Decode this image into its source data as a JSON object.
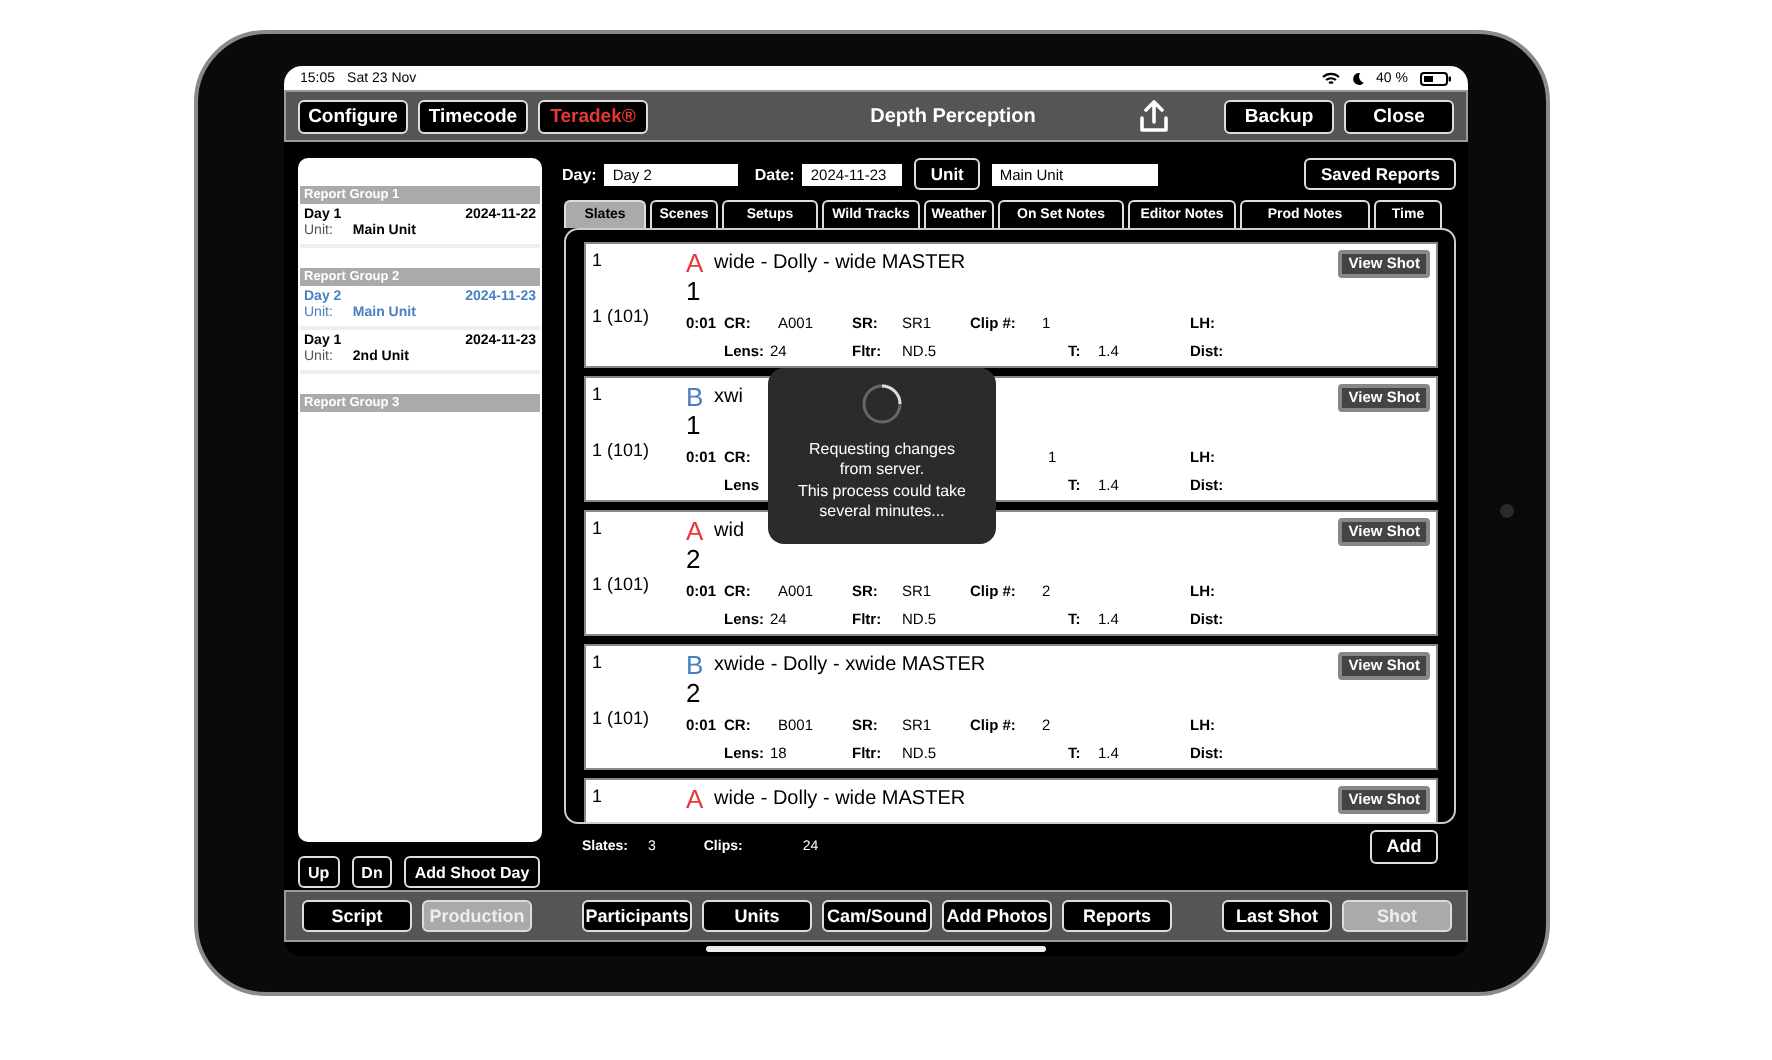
{
  "status_bar": {
    "time": "15:05",
    "date": "Sat 23 Nov",
    "battery": "40 %"
  },
  "toolbar": {
    "buttons_left": [
      {
        "label": "Configure",
        "kind": "normal"
      },
      {
        "label": "Timecode",
        "kind": "normal"
      },
      {
        "label": "Teradek®",
        "kind": "alert"
      }
    ],
    "title": "Depth Perception",
    "buttons_right": [
      "Backup",
      "Close"
    ]
  },
  "form": {
    "day_label": "Day:",
    "day": "Day 2",
    "date_label": "Date:",
    "date": "2024-11-23",
    "unit_button": "Unit",
    "unit": "Main Unit",
    "saved_reports": "Saved Reports"
  },
  "tabs": [
    {
      "label": "Slates",
      "selected": true
    },
    {
      "label": "Scenes",
      "selected": false
    },
    {
      "label": "Setups",
      "selected": false
    },
    {
      "label": "Wild Tracks",
      "selected": false
    },
    {
      "label": "Weather",
      "selected": false
    },
    {
      "label": "On Set Notes",
      "selected": false
    },
    {
      "label": "Editor Notes",
      "selected": false
    },
    {
      "label": "Prod Notes",
      "selected": false
    },
    {
      "label": "Time",
      "selected": false
    }
  ],
  "sidebar": {
    "groups": [
      {
        "title": "Report Group 1",
        "items": [
          {
            "day": "Day 1",
            "date": "2024-11-22",
            "unit_label": "Unit:",
            "unit": "Main Unit",
            "selected": false
          }
        ]
      },
      {
        "title": "Report Group 2",
        "items": [
          {
            "day": "Day 2",
            "date": "2024-11-23",
            "unit_label": "Unit:",
            "unit": "Main Unit",
            "selected": true
          },
          {
            "day": "Day 1",
            "date": "2024-11-23",
            "unit_label": "Unit:",
            "unit": "2nd Unit",
            "selected": false
          }
        ]
      },
      {
        "title": "Report Group 3"
      }
    ],
    "buttons": [
      "Up",
      "Dn",
      "Add Shoot Day"
    ]
  },
  "slates": {
    "rows": [
      {
        "scene": "1",
        "camera": "A",
        "color": "#e53935",
        "title": "wide - Dolly - wide MASTER",
        "take": "1",
        "slate": "1 (101)",
        "duration": "0:01",
        "line_1": [
          {
            "kind": "cr",
            "label": "CR:",
            "value": "A001"
          },
          {
            "kind": "sr",
            "label": "SR:",
            "value": "SR1"
          },
          {
            "kind": "clip",
            "label": "Clip #:",
            "value": "1"
          },
          {
            "kind": "lh",
            "label": "LH:"
          }
        ],
        "line_2": [
          {
            "kind": "lens",
            "label": "Lens:",
            "value": "24"
          },
          {
            "kind": "filter",
            "label": "Fltr:",
            "value": "ND.5"
          },
          {
            "kind": "tstop",
            "label": "T:",
            "value": "1.4"
          },
          {
            "kind": "dist",
            "label": "Dist:"
          }
        ],
        "button": "View Shot"
      },
      {
        "scene": "1",
        "camera": "B",
        "color": "#4a7fc1",
        "title": "xwi",
        "take": "1",
        "slate": "1 (101)",
        "duration": "0:01",
        "line_1": [
          {
            "kind": "cr",
            "label": "CR:"
          },
          {
            "kind": "clip",
            "value": "1"
          },
          {
            "kind": "lh",
            "label": "LH:"
          }
        ],
        "line_2": [
          {
            "kind": "lens",
            "label": "Lens"
          },
          {
            "kind": "tstop",
            "label": "T:",
            "value": "1.4"
          },
          {
            "kind": "dist",
            "label": "Dist:"
          }
        ],
        "button": "View Shot"
      },
      {
        "scene": "1",
        "camera": "A",
        "color": "#e53935",
        "title": "wid",
        "take": "2",
        "slate": "1 (101)",
        "duration": "0:01",
        "line_1": [
          {
            "kind": "cr",
            "label": "CR:",
            "value": "A001"
          },
          {
            "kind": "sr",
            "label": "SR:",
            "value": "SR1"
          },
          {
            "kind": "clip",
            "label": "Clip #:",
            "value": "2"
          },
          {
            "kind": "lh",
            "label": "LH:"
          }
        ],
        "line_2": [
          {
            "kind": "lens",
            "label": "Lens:",
            "value": "24"
          },
          {
            "kind": "filter",
            "label": "Fltr:",
            "value": "ND.5"
          },
          {
            "kind": "tstop",
            "label": "T:",
            "value": "1.4"
          },
          {
            "kind": "dist",
            "label": "Dist:"
          }
        ],
        "button": "View Shot"
      },
      {
        "scene": "1",
        "camera": "B",
        "color": "#4a7fc1",
        "title": "xwide - Dolly - xwide MASTER",
        "take": "2",
        "slate": "1 (101)",
        "duration": "0:01",
        "line_1": [
          {
            "kind": "cr",
            "label": "CR:",
            "value": "B001"
          },
          {
            "kind": "sr",
            "label": "SR:",
            "value": "SR1"
          },
          {
            "kind": "clip",
            "label": "Clip #:",
            "value": "2"
          },
          {
            "kind": "lh",
            "label": "LH:"
          }
        ],
        "line_2": [
          {
            "kind": "lens",
            "label": "Lens:",
            "value": "18"
          },
          {
            "kind": "filter",
            "label": "Fltr:",
            "value": "ND.5"
          },
          {
            "kind": "tstop",
            "label": "T:",
            "value": "1.4"
          },
          {
            "kind": "dist",
            "label": "Dist:"
          }
        ],
        "button": "View Shot"
      },
      {
        "scene": "1",
        "camera": "A",
        "color": "#e53935",
        "title": "wide - Dolly - wide MASTER",
        "button": "View Shot"
      }
    ],
    "footer": {
      "slates_label": "Slates:",
      "slates": "3",
      "clips_label": "Clips:",
      "clips": "24",
      "add": "Add"
    }
  },
  "overlay": {
    "message": "Requesting changes\nfrom server.\nThis process could take\nseveral minutes..."
  },
  "bottom_bar": {
    "groups": [
      {
        "buttons": [
          {
            "label": "Script",
            "selected": false
          },
          {
            "label": "Production",
            "selected": true
          }
        ]
      },
      {
        "buttons": [
          {
            "label": "Participants",
            "selected": false
          },
          {
            "label": "Units",
            "selected": false
          },
          {
            "label": "Cam/Sound",
            "selected": false
          },
          {
            "label": "Add Photos",
            "selected": false
          },
          {
            "label": "Reports",
            "selected": false
          }
        ]
      },
      {
        "buttons": [
          {
            "label": "Last Shot",
            "selected": false
          },
          {
            "label": "Shot",
            "selected": true
          }
        ]
      }
    ]
  }
}
